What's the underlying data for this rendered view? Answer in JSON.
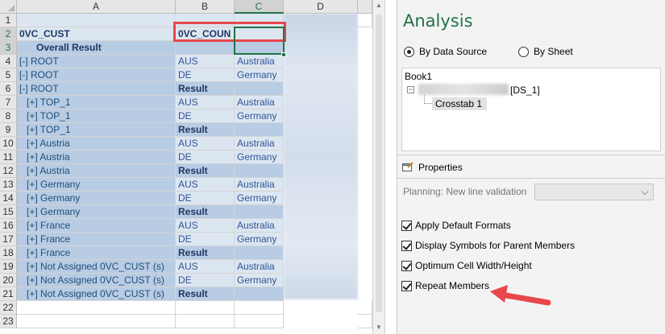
{
  "sheet": {
    "columns": [
      "A",
      "B",
      "C",
      "D"
    ],
    "rows": [
      "1",
      "2",
      "3",
      "4",
      "5",
      "6",
      "7",
      "8",
      "9",
      "10",
      "11",
      "12",
      "13",
      "14",
      "15",
      "16",
      "17",
      "18",
      "19",
      "20",
      "21",
      "22",
      "23"
    ],
    "a2": "0VC_CUST",
    "b2": "0VC_COUN",
    "a3": "Overall Result",
    "col_a": [
      "[-] ROOT",
      "[-] ROOT",
      "[-] ROOT",
      "[+] TOP_1",
      "[+] TOP_1",
      "[+] TOP_1",
      "[+] Austria",
      "[+] Austria",
      "[+] Austria",
      "[+] Germany",
      "[+] Germany",
      "[+] Germany",
      "[+] France",
      "[+] France",
      "[+] France",
      "[+] Not Assigned 0VC_CUST (s)",
      "[+] Not Assigned 0VC_CUST (s)",
      "[+] Not Assigned 0VC_CUST (s)"
    ],
    "col_b": [
      "AUS",
      "DE",
      "Result",
      "AUS",
      "DE",
      "Result",
      "AUS",
      "DE",
      "Result",
      "AUS",
      "DE",
      "Result",
      "AUS",
      "DE",
      "Result",
      "AUS",
      "DE",
      "Result"
    ],
    "col_c": [
      "Australia",
      "Germany",
      "",
      "Australia",
      "Germany",
      "",
      "Australia",
      "Germany",
      "",
      "Australia",
      "Germany",
      "",
      "Australia",
      "Germany",
      "",
      "Australia",
      "Germany",
      ""
    ]
  },
  "pane": {
    "title": "Analysis",
    "radio_by_data_source": "By Data Source",
    "radio_by_sheet": "By Sheet",
    "tree_root": "Book1",
    "tree_ds": "[DS_1]",
    "tree_crosstab": "Crosstab 1",
    "properties_label": "Properties",
    "planning_label": "Planning: New line validation",
    "checks": [
      {
        "label": "Apply Default Formats",
        "checked": true
      },
      {
        "label": "Display Symbols for Parent Members",
        "checked": true
      },
      {
        "label": "Optimum Cell Width/Height",
        "checked": true
      },
      {
        "label": "Repeat Members",
        "checked": true
      }
    ]
  },
  "colors": {
    "excel_green": "#217346",
    "highlight_red": "#e8474a",
    "cell_dark_blue": "#b8cce4",
    "cell_light_blue": "#dce6f1"
  }
}
